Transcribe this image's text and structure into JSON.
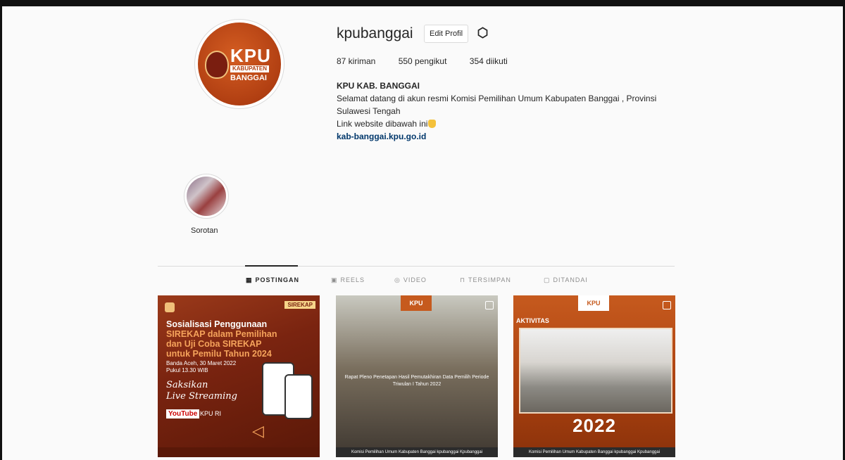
{
  "profile": {
    "username": "kpubanggai",
    "edit_label": "Edit Profil",
    "stats": {
      "posts": "87 kiriman",
      "followers": "550 pengikut",
      "following": "354 diikuti"
    },
    "bio_name": "KPU KAB. BANGGAI",
    "bio_line1": "Selamat datang di akun resmi Komisi Pemilihan Umum Kabupaten Banggai , Provinsi",
    "bio_line2": "Sulawesi Tengah",
    "bio_line3": "Link website dibawah ini",
    "website": "kab-banggai.kpu.go.id",
    "avatar": {
      "kpu": "KPU",
      "kab": "KABUPATEN",
      "name": "BANGGAI"
    }
  },
  "highlight": {
    "label": "Sorotan"
  },
  "tabs": [
    {
      "label": "POSTINGAN",
      "icon": "grid-icon"
    },
    {
      "label": "REELS",
      "icon": "reels-icon"
    },
    {
      "label": "VIDEO",
      "icon": "video-icon"
    },
    {
      "label": "TERSIMPAN",
      "icon": "bookmark-icon"
    },
    {
      "label": "DITANDAI",
      "icon": "tagged-icon"
    }
  ],
  "posts": [
    {
      "badge": "SIREKAP",
      "heading_1": "Sosialisasi Penggunaan",
      "heading_2": "SIREKAP dalam Pemilihan",
      "heading_3": "dan Uji Coba SIREKAP",
      "heading_4": "untuk Pemilu Tahun 2024",
      "sub_1": "Banda Aceh, 30 Maret 2022",
      "sub_2": "Pukul 13.30 WIB",
      "script_1": "Saksikan",
      "script_2": "Live Streaming",
      "yt": "YouTube",
      "yt_channel": "KPU RI"
    },
    {
      "tag": "KPU",
      "caption": "Rapat Pleno Penetapan Hasil Pemutakhiran Data Pemilih Periode Triwulan I Tahun 2022",
      "footer": "Komisi Pemilihan Umum Kabupaten Banggai  kpubanggai  Kpubanggai"
    },
    {
      "tag": "KPU",
      "activity": "AKTIVITAS",
      "year": "2022",
      "footer": "Komisi Pemilihan Umum Kabupaten Banggai  kpubanggai  Kpubanggai"
    }
  ]
}
